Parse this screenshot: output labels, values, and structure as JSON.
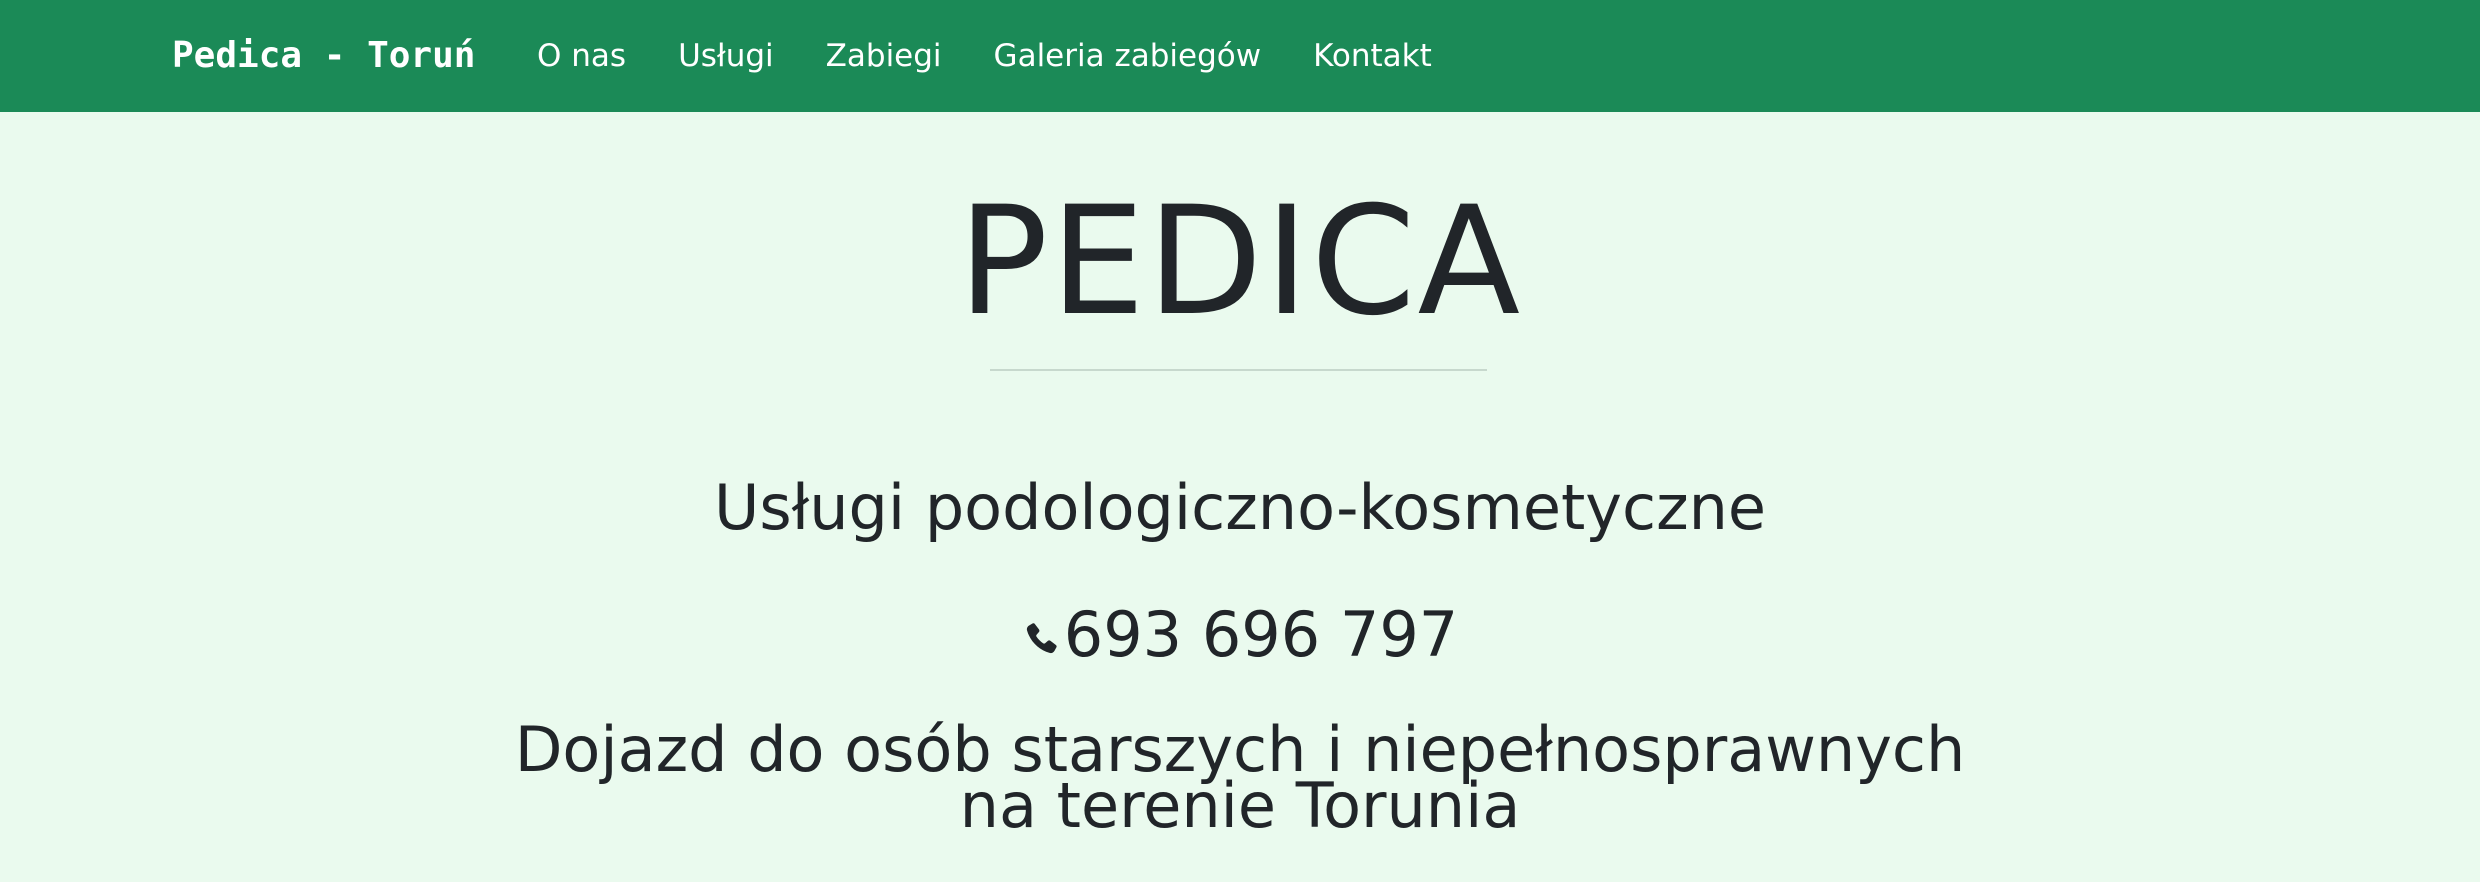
{
  "navbar": {
    "brand": "Pedica - Toruń",
    "links": [
      "O nas",
      "Usługi",
      "Zabiegi",
      "Galeria zabiegów",
      "Kontakt"
    ],
    "background_color": "#1b8a57"
  },
  "hero": {
    "title": "PEDICA",
    "subtitle": "Usługi podologiczno-kosmetyczne",
    "phone_icon": "phone-icon",
    "phone": "693 696 797",
    "travel_line1": "Dojazd do osób starszych i niepełnosprawnych",
    "travel_line2": "na terenie Torunia",
    "background_color": "#eafaee"
  }
}
